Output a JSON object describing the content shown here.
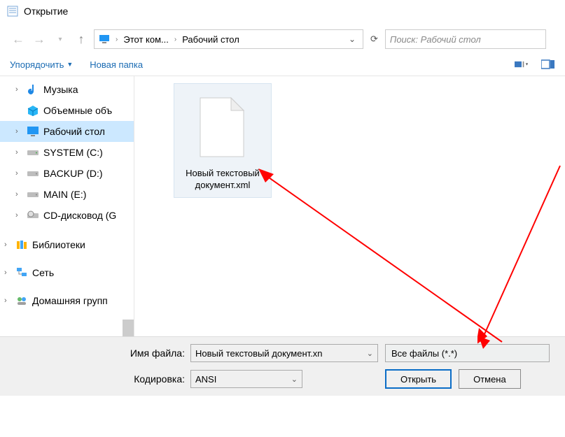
{
  "title": "Открытие",
  "breadcrumb": {
    "root": "Этот ком...",
    "leaf": "Рабочий стол"
  },
  "search": {
    "placeholder": "Поиск: Рабочий стол"
  },
  "toolbar": {
    "organize": "Упорядочить",
    "new_folder": "Новая папка"
  },
  "sidebar": {
    "items": [
      {
        "label": "Музыка"
      },
      {
        "label": "Объемные объ"
      },
      {
        "label": "Рабочий стол"
      },
      {
        "label": "SYSTEM (C:)"
      },
      {
        "label": "BACKUP (D:)"
      },
      {
        "label": "MAIN (E:)"
      },
      {
        "label": "CD-дисковод (G"
      }
    ],
    "groups": [
      {
        "label": "Библиотеки"
      },
      {
        "label": "Сеть"
      },
      {
        "label": "Домашняя групп"
      }
    ]
  },
  "file": {
    "name": "Новый текстовый документ.xml"
  },
  "footer": {
    "filename_label": "Имя файла:",
    "filename_value": "Новый текстовый документ.xn",
    "encoding_label": "Кодировка:",
    "encoding_value": "ANSI",
    "filetype": "Все файлы  (*.*)",
    "open": "Открыть",
    "cancel": "Отмена"
  }
}
